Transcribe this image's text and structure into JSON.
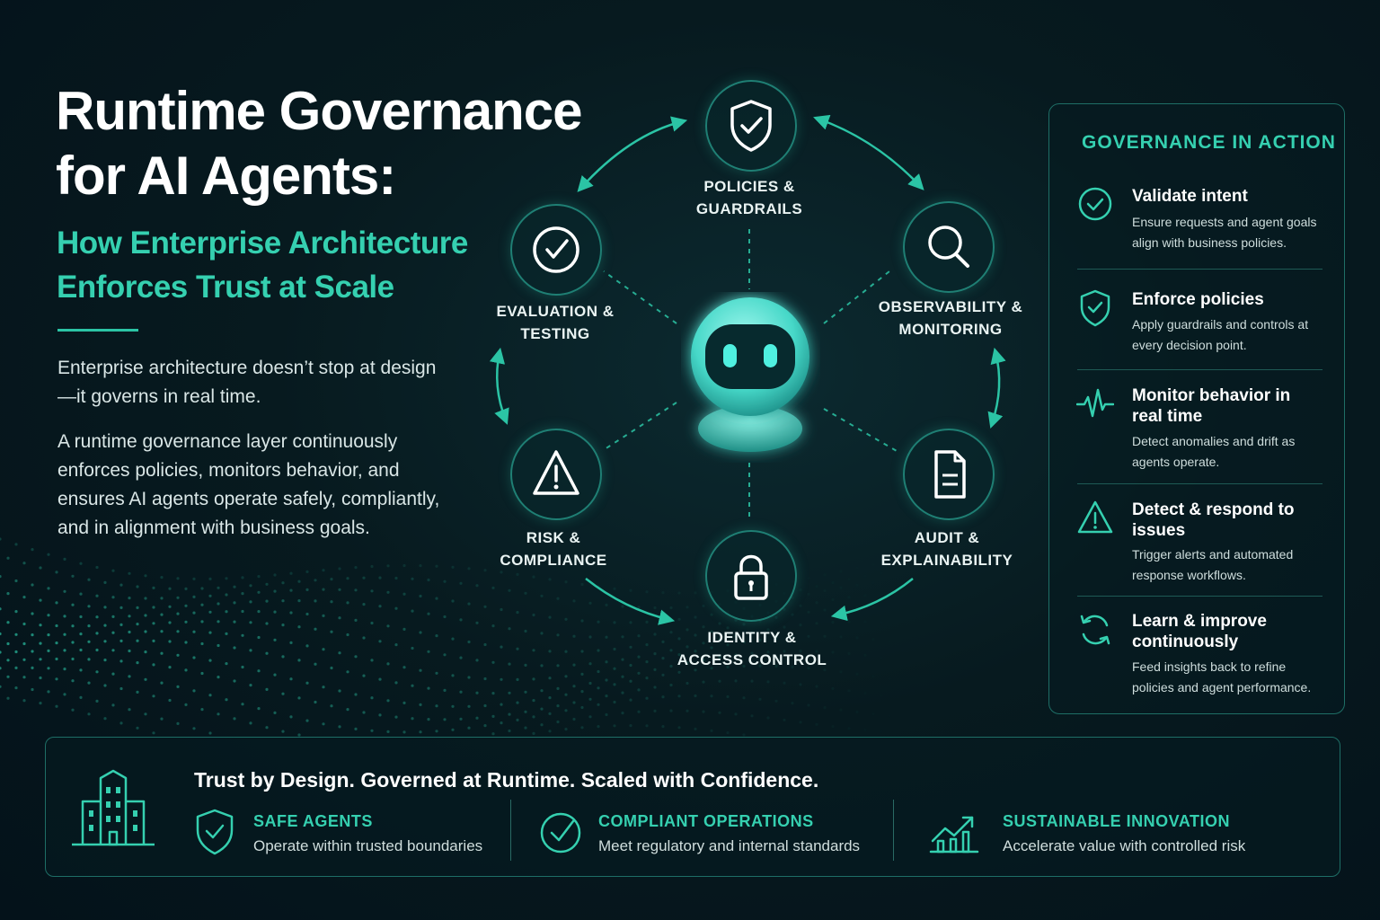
{
  "header": {
    "title_line1": "Runtime Governance",
    "title_line2": "for AI Agents:",
    "subtitle_line1": "How Enterprise Architecture",
    "subtitle_line2": "Enforces Trust at Scale"
  },
  "intro": {
    "paragraph1": "Enterprise architecture doesn’t stop at design—it governs in real time.",
    "paragraph2": "A runtime governance layer continuously enforces policies, monitors behavior, and ensures AI agents operate safely, compliantly, and in alignment with business goals."
  },
  "diagram": {
    "nodes": [
      {
        "line1": "POLICIES &",
        "line2": "GUARDRAILS",
        "icon": "shield-check-icon"
      },
      {
        "line1": "OBSERVABILITY &",
        "line2": "MONITORING",
        "icon": "magnifier-icon"
      },
      {
        "line1": "AUDIT &",
        "line2": "EXPLAINABILITY",
        "icon": "document-icon"
      },
      {
        "line1": "IDENTITY &",
        "line2": "ACCESS CONTROL",
        "icon": "padlock-icon"
      },
      {
        "line1": "RISK &",
        "line2": "COMPLIANCE",
        "icon": "warning-triangle-icon"
      },
      {
        "line1": "EVALUATION &",
        "line2": "TESTING",
        "icon": "check-circle-icon"
      }
    ],
    "center_icon": "robot-icon"
  },
  "panel": {
    "title": "GOVERNANCE IN ACTION",
    "items": [
      {
        "heading": "Validate intent",
        "desc": "Ensure requests and agent goals align with business policies.",
        "icon": "check-circle-icon"
      },
      {
        "heading": "Enforce policies",
        "desc": "Apply guardrails and controls at every decision point.",
        "icon": "shield-check-icon"
      },
      {
        "heading": "Monitor behavior in real time",
        "desc": "Detect anomalies and drift as agents operate.",
        "icon": "pulse-icon"
      },
      {
        "heading": "Detect & respond to issues",
        "desc": "Trigger alerts and automated response workflows.",
        "icon": "warning-triangle-icon"
      },
      {
        "heading": "Learn & improve continuously",
        "desc": "Feed insights back to refine policies and agent performance.",
        "icon": "refresh-icon"
      }
    ]
  },
  "footer": {
    "tagline": "Trust by Design. Governed at Runtime. Scaled with Confidence.",
    "building_icon": "building-icon",
    "columns": [
      {
        "heading": "SAFE AGENTS",
        "desc": "Operate within trusted boundaries",
        "icon": "shield-check-icon"
      },
      {
        "heading": "COMPLIANT OPERATIONS",
        "desc": "Meet regulatory and internal standards",
        "icon": "check-circle-icon"
      },
      {
        "heading": "SUSTAINABLE INNOVATION",
        "desc": "Accelerate value with controlled risk",
        "icon": "growth-chart-icon"
      }
    ]
  },
  "colors": {
    "accent": "#35d0b0",
    "background": "#071a1f",
    "robot_glow": "#4ff0e0"
  }
}
